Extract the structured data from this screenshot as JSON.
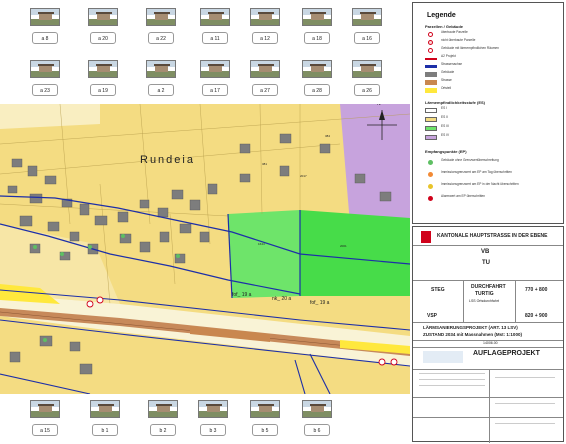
{
  "photos_top": [
    "a 8",
    "a 20",
    "a 22",
    "a 11",
    "a 12",
    "a 18",
    "a 16"
  ],
  "photos_mid": [
    "a 23",
    "a 19",
    "a 2",
    "a 17",
    "a 27",
    "a 28",
    "a 26"
  ],
  "photos_bottom": [
    "a 15",
    "b 1",
    "b 2",
    "b 3",
    "b 5",
    "b 6"
  ],
  "map": {
    "place_name": "Rundeia",
    "track_labels": [
      "fof_ 19 a",
      "nk_ 20 a",
      "fof_ 19 a"
    ],
    "parcel_numbers": [
      "381",
      "384",
      "1644",
      "2001",
      "2017"
    ]
  },
  "legend": {
    "title": "Legende",
    "section1": "Parzellen / Gebäude",
    "section1_items": [
      "überbaute Parzelle",
      "nicht überbaute Parzelle",
      "Gebäude mit lärmempfindlichen Räumen",
      "A2 Projekt",
      "Strassenachse",
      "Gebäude",
      "Strasse",
      "Ortsteil"
    ],
    "section2": "Lärmempfindlichkeitsstufe (ES)",
    "es_items": [
      "ES I",
      "ES II",
      "ES III",
      "ES IV"
    ],
    "section3": "Empfangspunkte (EP)",
    "ep_items": [
      "Gebäude ohne Grenzwertüberschreitung",
      "Immissionsgrenzwert am EP am Tag überschritten",
      "Immissionsgrenzwert am EP in der Nacht überschritten",
      "Alarmwert am EP überschritten"
    ]
  },
  "titleblock": {
    "header": "KANTONALE HAUPTSTRASSE IN DER EBENE",
    "strecke": "VB",
    "ortschaft": "TU",
    "abschnitt": "DURCHFAHRT",
    "stadt": "TURTIG",
    "strasse": "LSS Ortsdurchfahrt",
    "station_left": "STEG",
    "station_right1": "770 + 800",
    "station_right2": "820 + 900",
    "bottom_left": "VSP",
    "project_title_1": "LÄRMSANIERUNGSPROJEKT (ART. 13 LSV)",
    "project_title_2": "ZUSTAND 2034 mit Massnahmen (Mst: 1:1000)",
    "company": "AUFLAGEPROJEKT",
    "plan_nr": "14006.00",
    "scale_marker": "N"
  }
}
